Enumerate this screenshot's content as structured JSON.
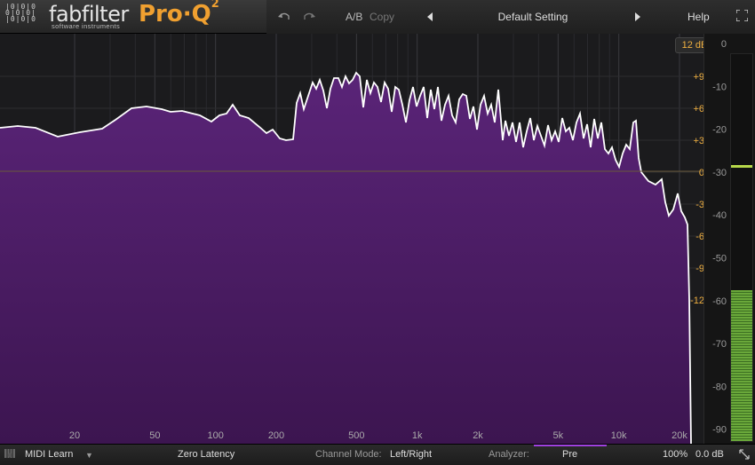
{
  "header": {
    "logo_mark": "|0|0|0\n0|0|0|\n|0|0|0",
    "brand": "fabfilter",
    "brand_sub": "software instruments",
    "product": "Pro·Q",
    "product_version": "2",
    "undo_icon": "undo-icon",
    "redo_icon": "redo-icon",
    "ab_label": "A/B",
    "copy_label": "Copy",
    "preset_name": "Default Setting",
    "help_label": "Help"
  },
  "display": {
    "range_button": "12 dB",
    "eq_scale": [
      "+9",
      "+6",
      "+3",
      "0",
      "-3",
      "-6",
      "-9",
      "-12"
    ],
    "analyzer_scale": [
      "0",
      "-10",
      "-20",
      "-30",
      "-40",
      "-50",
      "-60",
      "-70",
      "-80",
      "-90"
    ],
    "freq_labels": [
      "20",
      "50",
      "100",
      "200",
      "500",
      "1k",
      "2k",
      "5k",
      "10k",
      "20k"
    ],
    "colors": {
      "spectrum_fill": "#4e1f66",
      "spectrum_line": "#ffffff",
      "eq_scale": "#f0b040",
      "meter": "#6aa83a"
    }
  },
  "meter": {
    "level_db": -55,
    "peak_db": -26
  },
  "footer": {
    "midi_learn": "MIDI Learn",
    "latency": "Zero Latency",
    "channel_mode_label": "Channel Mode:",
    "channel_mode_value": "Left/Right",
    "analyzer_label": "Analyzer:",
    "analyzer_value": "Pre",
    "zoom": "100%",
    "output_gain": "0.0 dB"
  }
}
